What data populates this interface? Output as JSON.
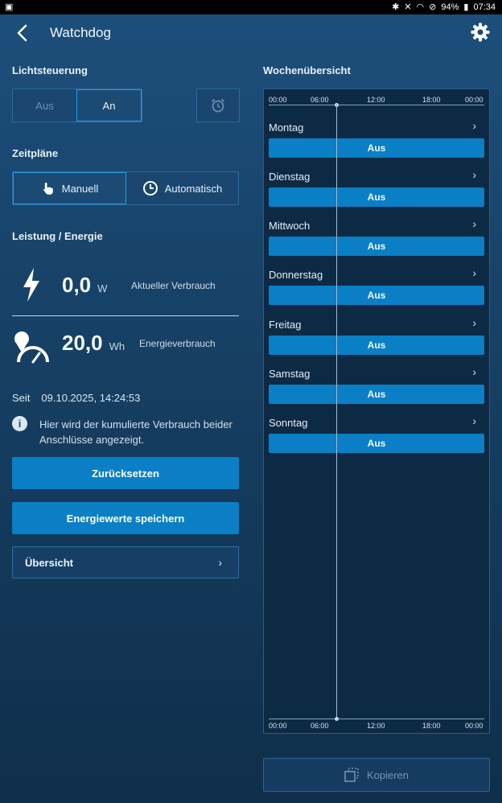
{
  "status_bar": {
    "battery": "94%",
    "time": "07:34"
  },
  "header": {
    "title": "Watchdog"
  },
  "light_control": {
    "title": "Lichtsteuerung",
    "off_label": "Aus",
    "on_label": "An",
    "selected": "An"
  },
  "schedules": {
    "title": "Zeitpläne",
    "manual_label": "Manuell",
    "auto_label": "Automatisch",
    "selected": "Manuell"
  },
  "power": {
    "title": "Leistung / Energie",
    "current": {
      "value": "0,0",
      "unit": "W",
      "label": "Aktueller Verbrauch"
    },
    "energy": {
      "value": "20,0",
      "unit": "Wh",
      "label": "Energieverbrauch"
    },
    "since_label": "Seit",
    "since_date": "09.10.2025, 14:24:53",
    "info_text": "Hier wird der kumulierte Verbrauch beider Anschlüsse angezeigt."
  },
  "buttons": {
    "reset": "Zurücksetzen",
    "save": "Energiewerte speichern",
    "overview": "Übersicht",
    "copy": "Kopieren"
  },
  "week": {
    "title": "Wochenübersicht",
    "times": [
      "00:00",
      "06:00",
      "12:00",
      "18:00",
      "00:00"
    ],
    "days": [
      {
        "name": "Montag",
        "state": "Aus"
      },
      {
        "name": "Dienstag",
        "state": "Aus"
      },
      {
        "name": "Mittwoch",
        "state": "Aus"
      },
      {
        "name": "Donnerstag",
        "state": "Aus"
      },
      {
        "name": "Freitag",
        "state": "Aus"
      },
      {
        "name": "Samstag",
        "state": "Aus"
      },
      {
        "name": "Sonntag",
        "state": "Aus"
      }
    ]
  },
  "colors": {
    "accent": "#0a7fc6",
    "selected_border": "#1fa0e6"
  }
}
